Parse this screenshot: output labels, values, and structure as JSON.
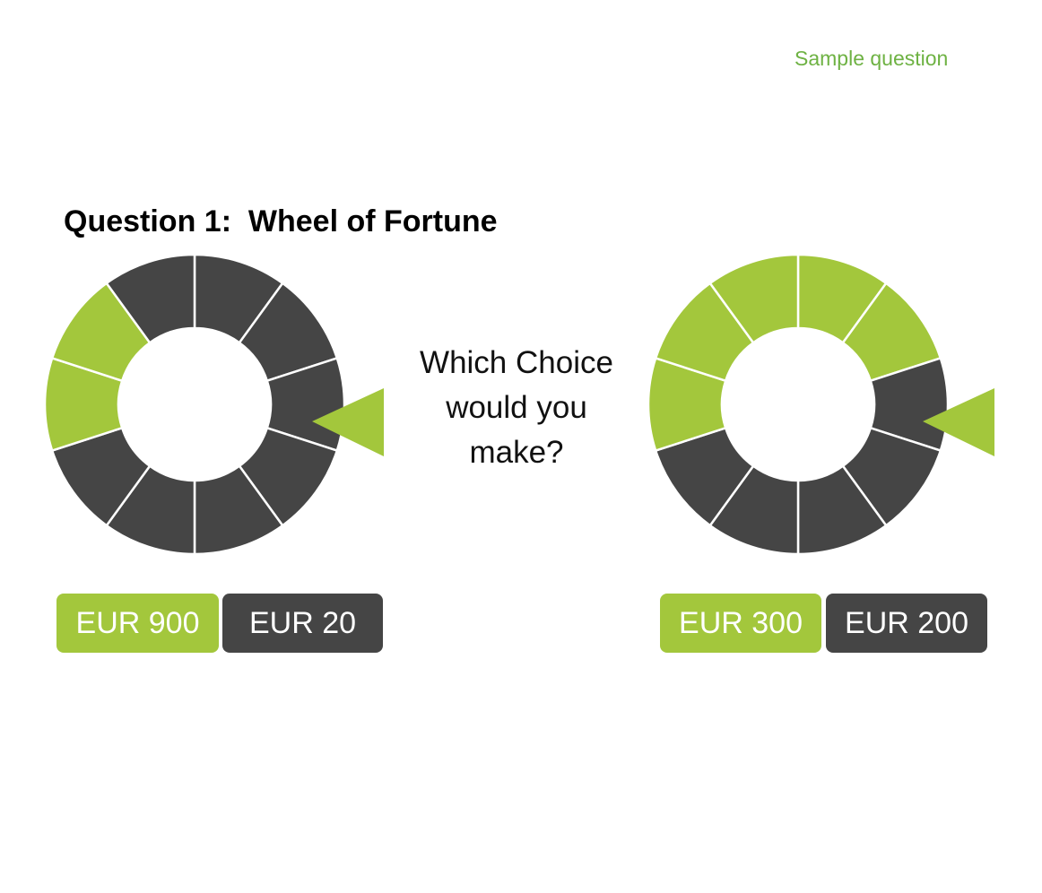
{
  "header": {
    "tag": "Sample question"
  },
  "question": {
    "title": "Question 1:  Wheel of Fortune",
    "prompt_lines": [
      "Which Choice",
      "would you",
      "make?"
    ]
  },
  "colors": {
    "win": "#a3c73c",
    "lose": "#454545",
    "pointer": "#a3c73c",
    "separator": "#ffffff",
    "tag": "#6eb243"
  },
  "wheels": [
    {
      "id": "left",
      "segments": [
        "lose",
        "lose",
        "lose",
        "lose",
        "lose",
        "lose",
        "lose",
        "win",
        "win",
        "lose"
      ],
      "win_share": 0.2,
      "prizes": {
        "win": "EUR 900",
        "lose": "EUR 20"
      }
    },
    {
      "id": "right",
      "segments": [
        "win",
        "win",
        "lose",
        "lose",
        "lose",
        "lose",
        "lose",
        "win",
        "win",
        "win"
      ],
      "win_share": 0.5,
      "prizes": {
        "win": "EUR 300",
        "lose": "EUR 200"
      }
    }
  ]
}
